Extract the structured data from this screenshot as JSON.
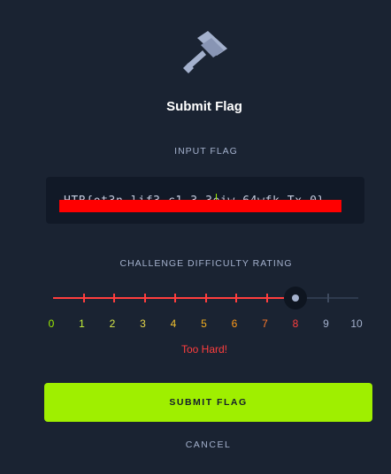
{
  "dialog": {
    "title": "Submit Flag",
    "input_label": "INPUT FLAG",
    "input_value": "HTB{ot3n_lif3_c1_3  3eiw_64wfk_Tx_0}",
    "rating_label": "CHALLENGE DIFFICULTY RATING",
    "rating_text": "Too Hard!",
    "submit_label": "SUBMIT FLAG",
    "cancel_label": "CANCEL"
  },
  "slider": {
    "value": 8,
    "min": 0,
    "max": 10,
    "tick_labels": [
      "0",
      "1",
      "2",
      "3",
      "4",
      "5",
      "6",
      "7",
      "8",
      "9",
      "10"
    ],
    "tick_colors": [
      "#9fef00",
      "#c5f23a",
      "#d8e84a",
      "#e8d84a",
      "#f0c030",
      "#f5b020",
      "#ff9a1a",
      "#ff7a2a",
      "#ff3e3e",
      "#a4b1cd",
      "#a4b1cd"
    ]
  },
  "colors": {
    "accent": "#9fef00",
    "danger": "#ff3e3e",
    "background": "#1a2332",
    "muted": "#a4b1cd"
  },
  "icons": {
    "header": "flag-icon"
  }
}
